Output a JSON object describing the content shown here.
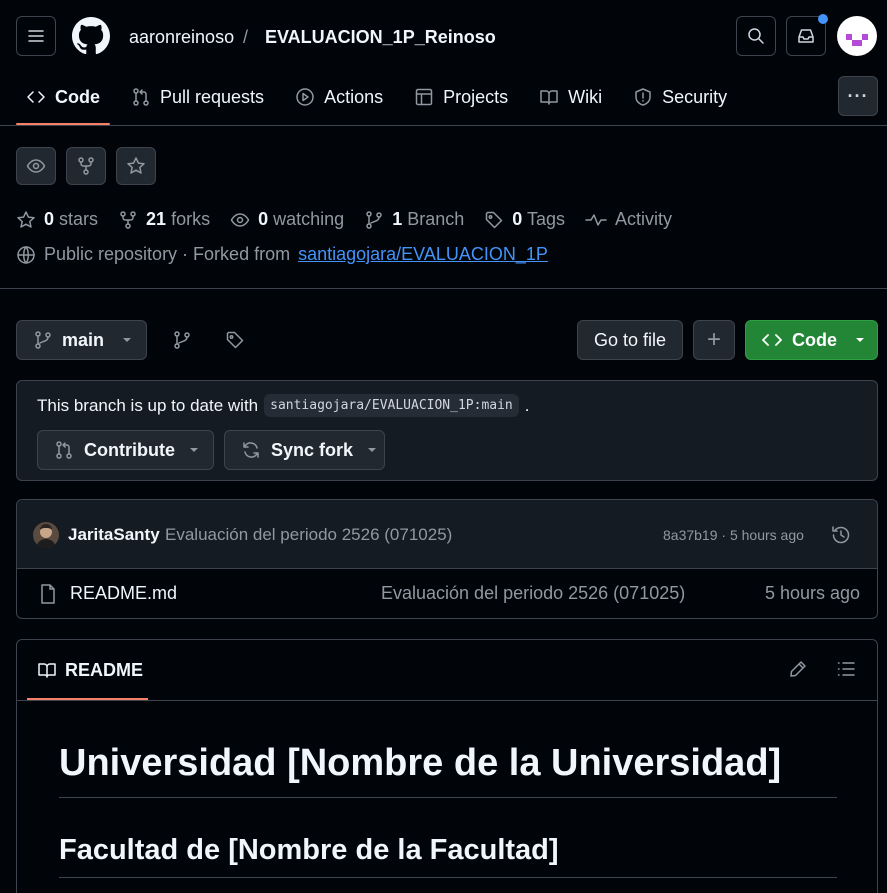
{
  "header": {
    "owner": "aaronreinoso",
    "separator": "/",
    "repo": "EVALUACION_1P_Reinoso"
  },
  "nav": {
    "tabs": [
      {
        "label": "Code",
        "active": true,
        "icon": "code-icon"
      },
      {
        "label": "Pull requests",
        "icon": "pull-request-icon"
      },
      {
        "label": "Actions",
        "icon": "play-icon"
      },
      {
        "label": "Projects",
        "icon": "table-icon"
      },
      {
        "label": "Wiki",
        "icon": "book-icon"
      },
      {
        "label": "Security",
        "icon": "shield-icon"
      }
    ],
    "more": "···"
  },
  "stats": {
    "stars_count": "0",
    "stars_label": "stars",
    "forks_count": "21",
    "forks_label": "forks",
    "watching_count": "0",
    "watching_label": "watching",
    "branch_count": "1",
    "branch_label": "Branch",
    "tags_count": "0",
    "tags_label": "Tags",
    "activity_label": "Activity"
  },
  "repo_info": {
    "prefix": "Public repository · Forked from",
    "fork_source": "santiagojara/EVALUACION_1P"
  },
  "toolbar": {
    "branch": "main",
    "go_to_file": "Go to file",
    "add": "+",
    "code": "Code"
  },
  "sync": {
    "message_prefix": "This branch is up to date with",
    "upstream": "santiagojara/EVALUACION_1P:main",
    "message_suffix": ".",
    "contribute": "Contribute",
    "sync_fork": "Sync fork"
  },
  "commit": {
    "author": "JaritaSanty",
    "message": "Evaluación del periodo 2526 (071025)",
    "sha_time": "8a37b19 · 5 hours ago"
  },
  "files": [
    {
      "name": "README.md",
      "message": "Evaluación del periodo 2526 (071025)",
      "time": "5 hours ago"
    }
  ],
  "readme": {
    "tab": "README",
    "h1": "Universidad [Nombre de la Universidad]",
    "h2": "Facultad de [Nombre de la Facultad]"
  },
  "colors": {
    "accent_underline": "#f78166",
    "primary_button": "#238636",
    "link": "#4493f8",
    "notification_dot": "#4493f8"
  }
}
